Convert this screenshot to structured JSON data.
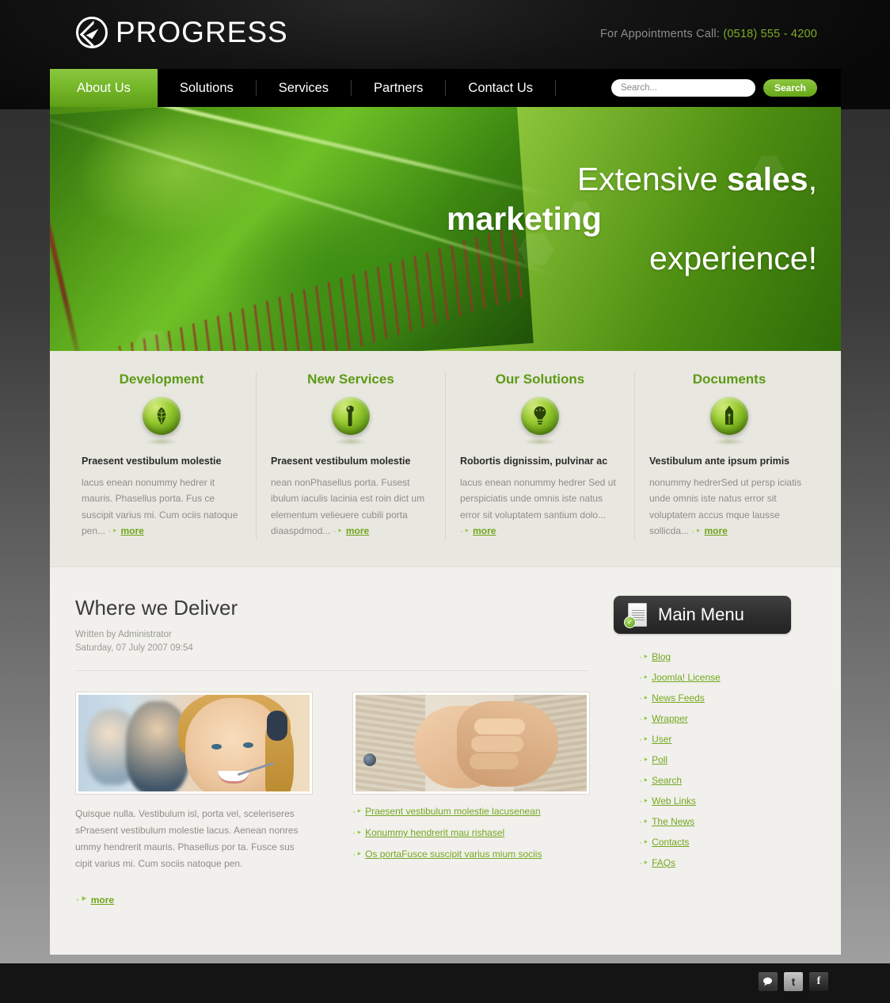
{
  "header": {
    "logo_text": "PROGRESS",
    "appointments_label": "For Appointments Call:",
    "phone": "(0518) 555 - 4200",
    "phone_color": "#7eac25"
  },
  "nav": {
    "items": [
      {
        "label": "About Us",
        "active": true
      },
      {
        "label": "Solutions",
        "active": false
      },
      {
        "label": "Services",
        "active": false
      },
      {
        "label": "Partners",
        "active": false
      },
      {
        "label": "Contact Us",
        "active": false
      }
    ],
    "search_placeholder": "Search...",
    "search_value": "",
    "search_button": "Search"
  },
  "hero": {
    "line1_plain": "Extensive ",
    "line1_bold": "sales",
    "line1_tail": ",",
    "line2_bold": "marketing",
    "line3": "experience!"
  },
  "features": [
    {
      "title": "Development",
      "icon": "leaf-icon",
      "subtitle": "Praesent vestibulum molestie",
      "body": "lacus enean nonummy hedrer it mauris. Phasellus porta. Fus ce suscipit varius mi. Cum ociis natoque pen...",
      "more": "more"
    },
    {
      "title": "New Services",
      "icon": "wrench-icon",
      "subtitle": "Praesent vestibulum molestie",
      "body": "nean nonPhasellus porta. Fusest ibulum iaculis lacinia est roin dict um elementum velieuere cubili porta diaaspdmod...",
      "more": "more"
    },
    {
      "title": "Our Solutions",
      "icon": "lightbulb-icon",
      "subtitle": "Robortis dignissim, pulvinar ac",
      "body": "lacus enean nonummy hedrer Sed ut perspiciatis unde omnis iste natus error sit voluptatem santium dolo...",
      "more": "more"
    },
    {
      "title": "Documents",
      "icon": "pen-nib-icon",
      "subtitle": "Vestibulum ante ipsum primis",
      "body": "nonummy hedrerSed ut persp iciatis unde omnis iste natus error sit voluptatem accus mque lausse sollicda...",
      "more": "more"
    }
  ],
  "article": {
    "title": "Where we Deliver",
    "author": "Written by Administrator",
    "date": "Saturday, 07 July 2007 09:54",
    "photo_left_name": "call-center-photo",
    "photo_right_name": "handshake-photo",
    "body": "Quisque nulla. Vestibulum isl, porta vel, sceleriseres sPraesent vestibulum molestie lacus. Aenean nonres ummy hendrerit mauris. Phasellus por ta. Fusce sus cipit varius mi. Cum sociis natoque pen.",
    "more": "more",
    "links": [
      "Praesent vestibulum molestie lacusenean",
      "Konummy hendrerit mau rishasel",
      "Os portaFusce suscipit varius mium sociis"
    ]
  },
  "sidebar": {
    "menu_title": "Main Menu",
    "menu_icon": "document-check-icon",
    "items": [
      "Blog",
      "Joomla! License",
      "News Feeds",
      "Wrapper",
      "User",
      "Poll",
      "Search",
      "Web Links",
      "The News",
      "Contacts",
      "FAQs"
    ]
  },
  "footer": {
    "social": [
      {
        "name": "comment-icon",
        "glyph": "✉"
      },
      {
        "name": "twitter-icon",
        "glyph": "t"
      },
      {
        "name": "facebook-icon",
        "glyph": "f"
      }
    ]
  },
  "colors": {
    "accent_green": "#7eac25",
    "link_green": "#74a820",
    "heading_green": "#5d9a14",
    "nav_active": "#76b82a",
    "page_bg": "#f1f0ec",
    "features_bg": "#e8e7e0"
  }
}
